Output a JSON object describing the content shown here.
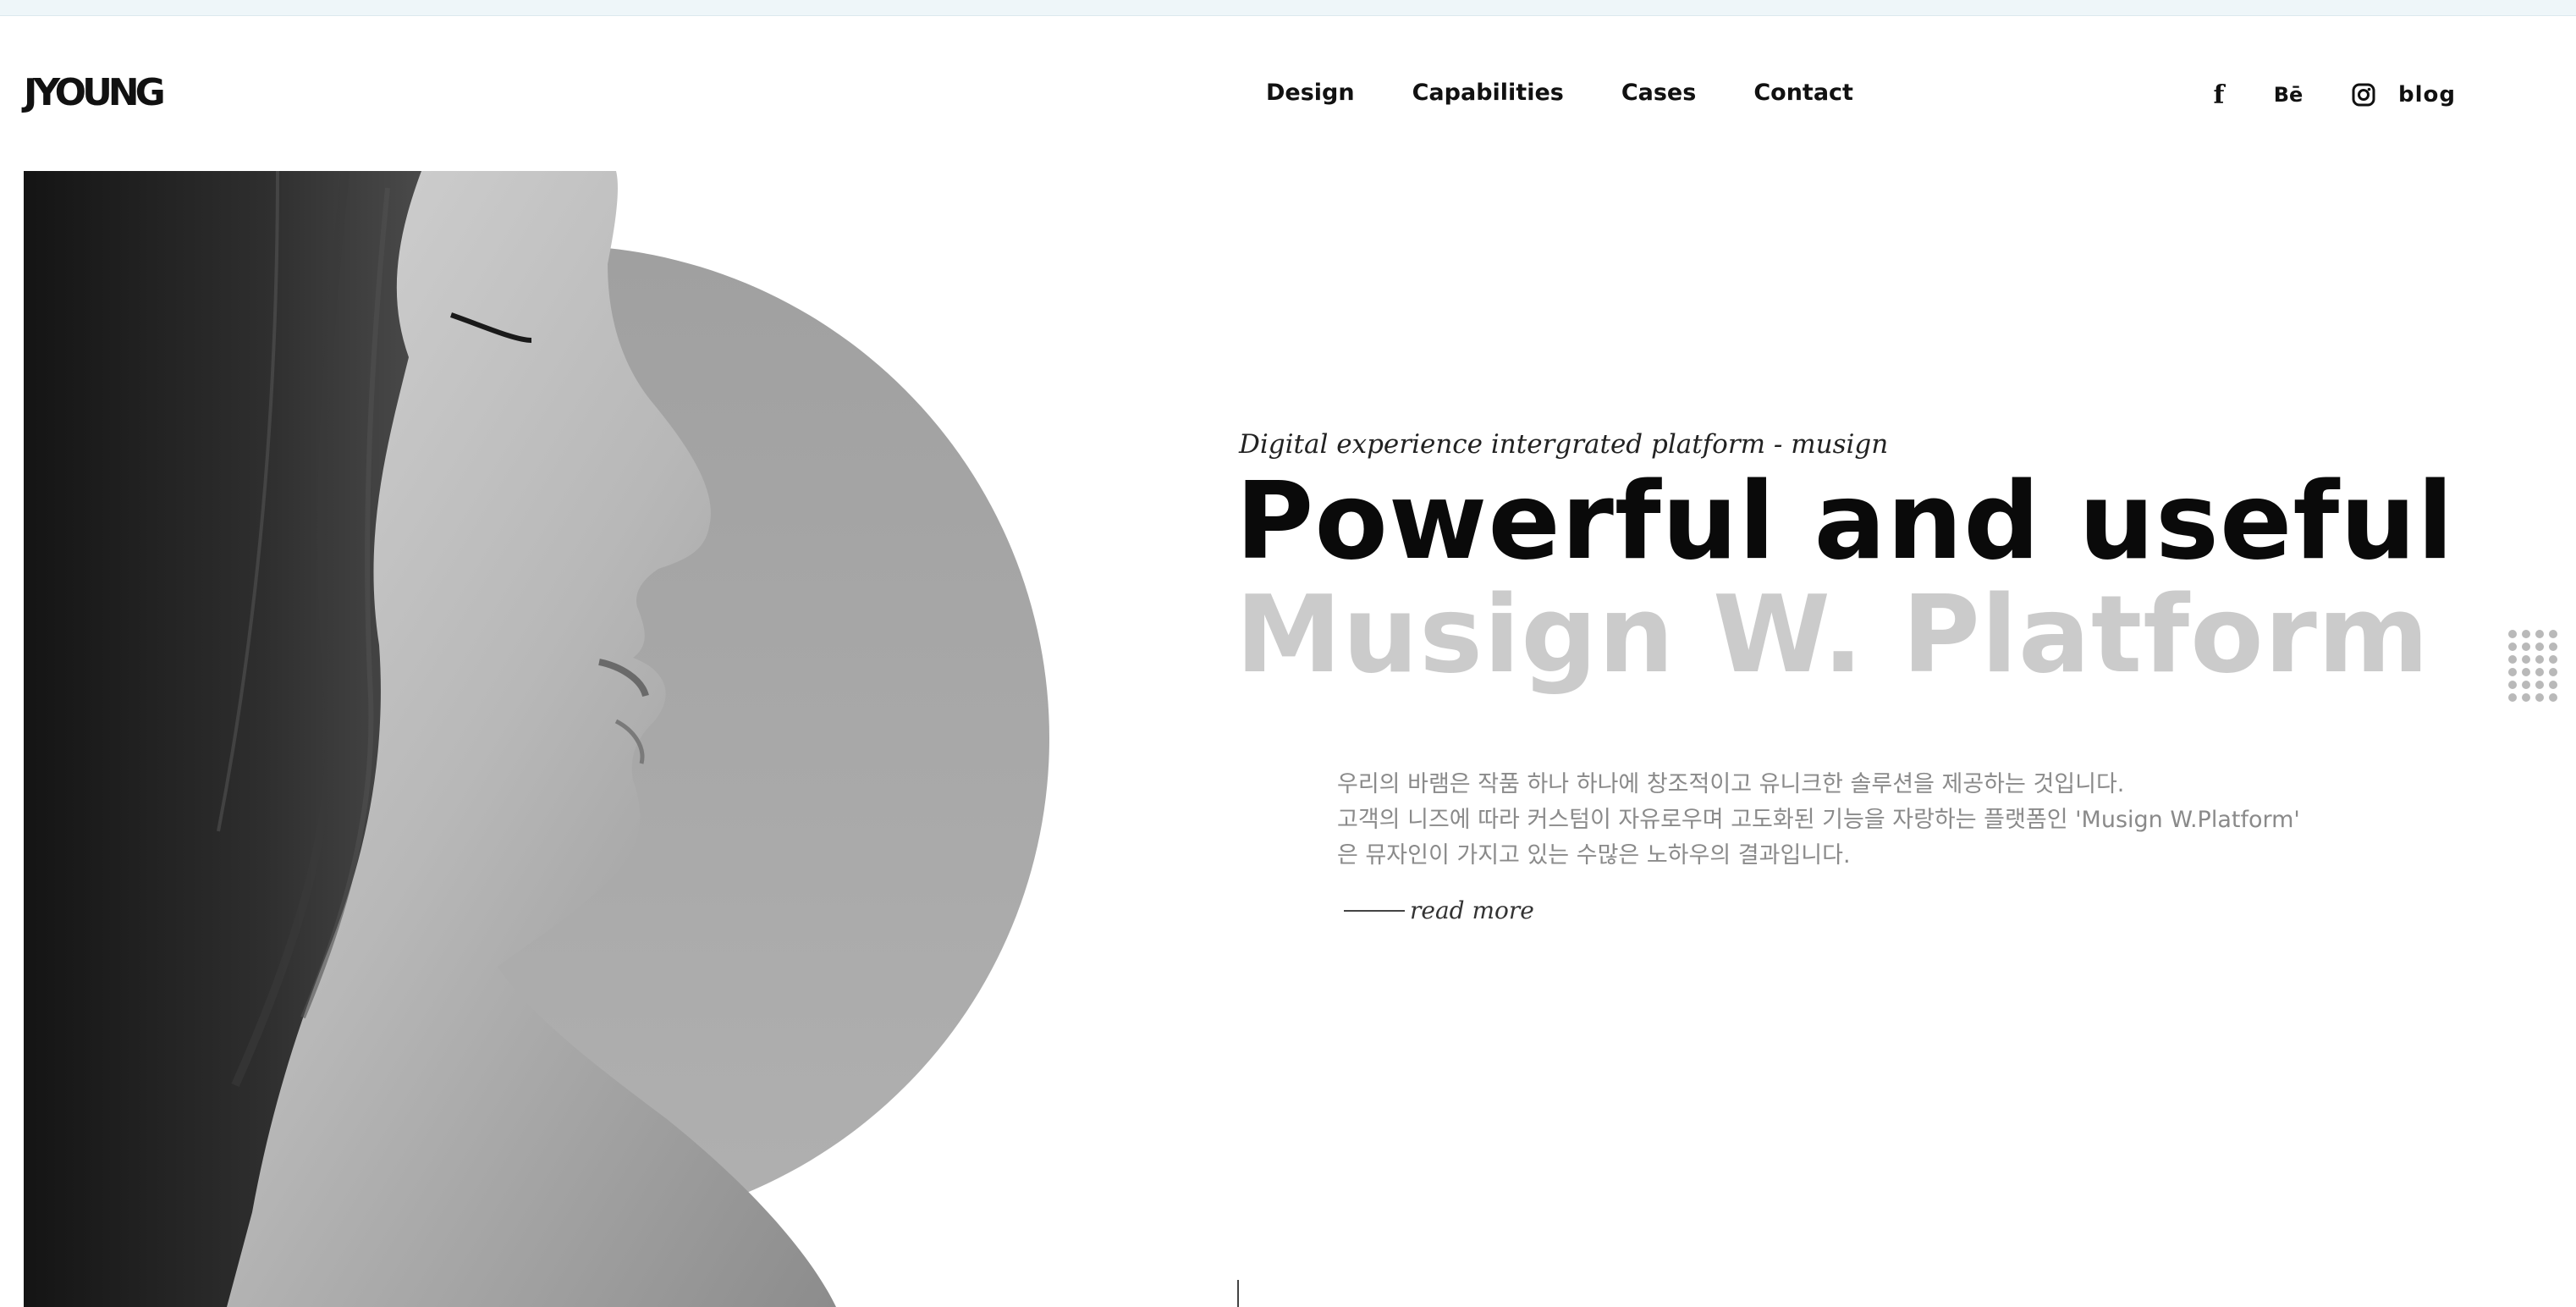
{
  "header": {
    "logo": "JYOUNG",
    "nav": [
      "Design",
      "Capabilities",
      "Cases",
      "Contact"
    ],
    "social": {
      "facebook": "f",
      "behance": "Bē",
      "blog": "blog"
    }
  },
  "hero": {
    "tagline": "Digital experience intergrated platform - musign",
    "headline_line1": "Powerful and useful",
    "headline_line2": "Musign W. Platform",
    "description": [
      "우리의 바램은 작품 하나 하나에 창조적이고 유니크한 솔루션을 제공하는 것입니다.",
      "고객의 니즈에 따라 커스텀이 자유로우며 고도화된 기능을 자랑하는 플랫폼인 'Musign W.Platform'",
      "은 뮤자인이 가지고 있는 수많은 노하우의 결과입니다."
    ],
    "read_more": "read more"
  },
  "icons": {
    "facebook": "facebook-icon",
    "behance": "behance-icon",
    "instagram": "instagram-icon",
    "menu": "dot-grid-menu-icon"
  },
  "colors": {
    "headline_primary": "#0a0a0a",
    "headline_secondary": "#cbcbcb",
    "description": "#8a8a8a",
    "circle": "#a6a6a6"
  }
}
